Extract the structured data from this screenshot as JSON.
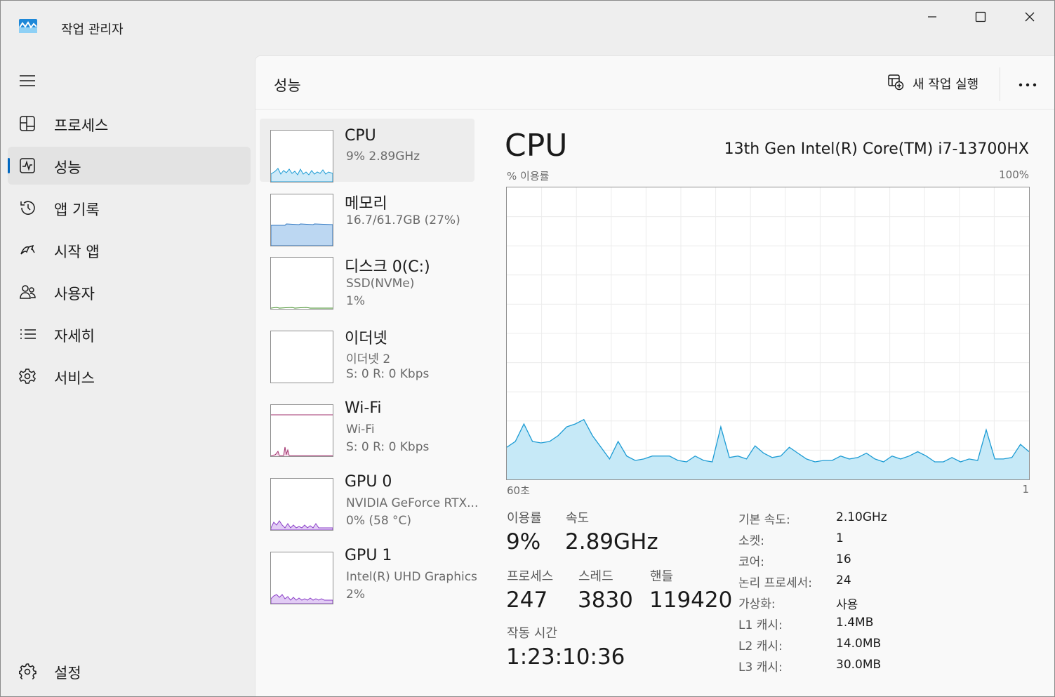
{
  "window": {
    "title": "작업 관리자",
    "controls": {
      "minimize": "minimize-icon",
      "maximize": "maximize-icon",
      "close": "close-icon"
    }
  },
  "sidebar": {
    "items": [
      {
        "label": "프로세스",
        "icon": "processes-icon"
      },
      {
        "label": "성능",
        "icon": "performance-icon",
        "active": true
      },
      {
        "label": "앱 기록",
        "icon": "history-icon"
      },
      {
        "label": "시작 앱",
        "icon": "startup-icon"
      },
      {
        "label": "사용자",
        "icon": "users-icon"
      },
      {
        "label": "자세히",
        "icon": "details-icon"
      },
      {
        "label": "서비스",
        "icon": "services-icon"
      }
    ],
    "settings": {
      "label": "설정",
      "icon": "settings-icon"
    }
  },
  "header": {
    "title": "성능",
    "run_task": "새 작업 실행",
    "more": "more-icon"
  },
  "resources": [
    {
      "name": "CPU",
      "sub1": "9%  2.89GHz",
      "sub2": "",
      "color": "#1b9bd4"
    },
    {
      "name": "메모리",
      "sub1": "16.7/61.7GB (27%)",
      "sub2": "",
      "color": "#2f76c0"
    },
    {
      "name": "디스크 0(C:)",
      "sub1": "SSD(NVMe)",
      "sub2": "1%",
      "color": "#3a8a1f"
    },
    {
      "name": "이더넷",
      "sub1": "이더넷 2",
      "sub2": "S: 0  R: 0 Kbps",
      "color": "#a74f01"
    },
    {
      "name": "Wi-Fi",
      "sub1": "Wi-Fi",
      "sub2": "S: 0  R: 0 Kbps",
      "color": "#a1326e"
    },
    {
      "name": "GPU 0",
      "sub1": "NVIDIA GeForce RTX...",
      "sub2": "0% (58 °C)",
      "color": "#8b3fc8"
    },
    {
      "name": "GPU 1",
      "sub1": "Intel(R) UHD Graphics",
      "sub2": "2%",
      "color": "#8b3fc8"
    }
  ],
  "detail": {
    "title": "CPU",
    "model": "13th Gen Intel(R) Core(TM) i7-13700HX",
    "axis": {
      "y_label": "% 이용률",
      "y_max": "100%",
      "x_left": "60초",
      "x_right": "1"
    },
    "stats": {
      "utilization": {
        "label": "이용률",
        "value": "9%"
      },
      "speed": {
        "label": "속도",
        "value": "2.89GHz"
      },
      "processes": {
        "label": "프로세스",
        "value": "247"
      },
      "threads": {
        "label": "스레드",
        "value": "3830"
      },
      "handles": {
        "label": "핸들",
        "value": "119420"
      },
      "uptime": {
        "label": "작동 시간",
        "value": "1:23:10:36"
      }
    },
    "specs": [
      {
        "key": "기본 속도:",
        "value": "2.10GHz"
      },
      {
        "key": "소켓:",
        "value": "1"
      },
      {
        "key": "코어:",
        "value": "16"
      },
      {
        "key": "논리 프로세서:",
        "value": "24"
      },
      {
        "key": "가상화:",
        "value": "사용"
      },
      {
        "key": "L1 캐시:",
        "value": "1.4MB"
      },
      {
        "key": "L2 캐시:",
        "value": "14.0MB"
      },
      {
        "key": "L3 캐시:",
        "value": "30.0MB"
      }
    ]
  },
  "chart_data": {
    "type": "area",
    "title": "",
    "xlabel": "",
    "ylabel": "% 이용률",
    "ylim": [
      0,
      100
    ],
    "x": [
      60,
      59,
      58,
      57,
      56,
      55,
      54,
      53,
      52,
      51,
      50,
      49,
      48,
      47,
      46,
      45,
      44,
      43,
      42,
      41,
      40,
      39,
      38,
      37,
      36,
      35,
      34,
      33,
      32,
      31,
      30,
      29,
      28,
      27,
      26,
      25,
      24,
      23,
      22,
      21,
      20,
      19,
      18,
      17,
      16,
      15,
      14,
      13,
      12,
      11,
      10,
      9,
      8,
      7,
      6,
      5,
      4,
      3,
      2,
      1
    ],
    "series": [
      {
        "values": [
          11,
          13,
          19,
          13,
          12.5,
          13,
          15,
          18,
          19,
          20.5,
          15,
          11,
          7,
          13,
          8,
          6.5,
          7,
          8,
          8,
          8,
          6.5,
          6,
          8,
          6.5,
          6,
          18,
          7.5,
          8,
          7,
          11.5,
          9,
          7.5,
          8,
          11,
          9,
          7,
          6,
          6.5,
          6.5,
          8,
          7,
          7.5,
          9,
          7,
          6,
          8,
          7,
          8,
          9.5,
          8,
          6,
          6,
          7.5,
          6,
          7,
          6.5,
          17,
          7,
          7,
          7.5,
          12,
          9.5
        ]
      }
    ]
  }
}
